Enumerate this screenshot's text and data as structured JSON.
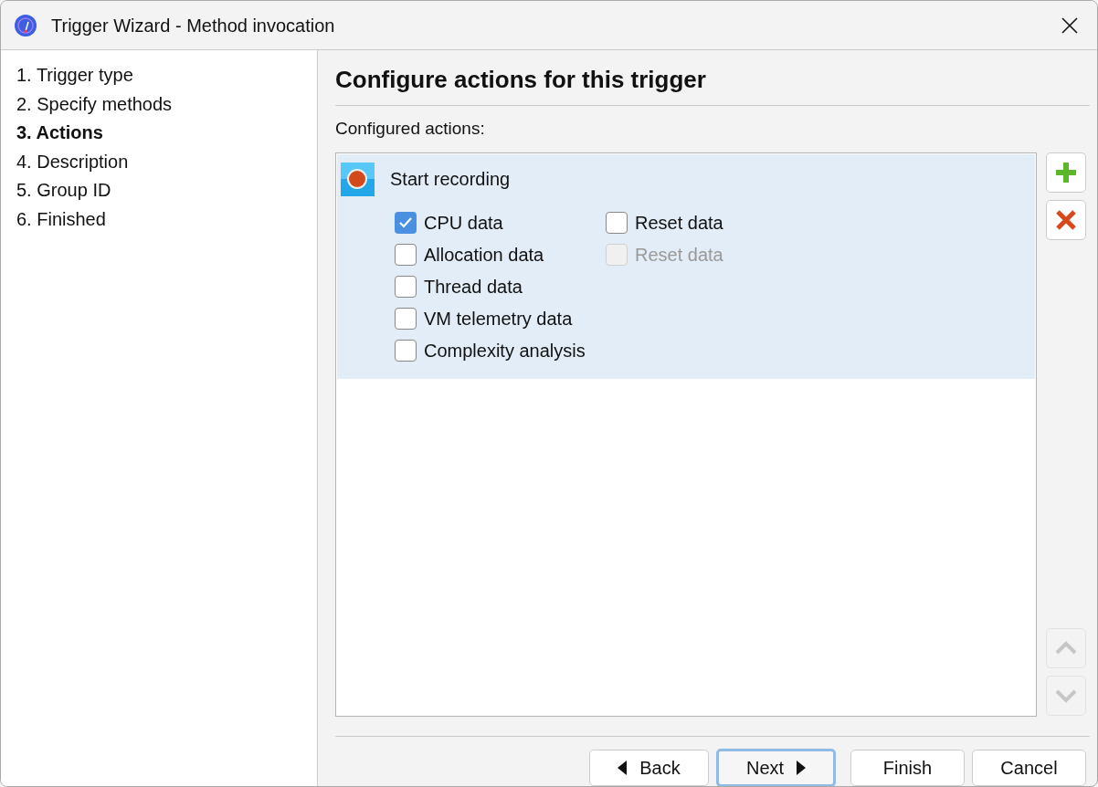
{
  "window": {
    "title": "Trigger Wizard - Method invocation"
  },
  "steps": [
    {
      "label": "1. Trigger type",
      "selected": false
    },
    {
      "label": "2. Specify methods",
      "selected": false
    },
    {
      "label": "3. Actions",
      "selected": true
    },
    {
      "label": "4. Description",
      "selected": false
    },
    {
      "label": "5. Group ID",
      "selected": false
    },
    {
      "label": "6. Finished",
      "selected": false
    }
  ],
  "heading": "Configure actions for this trigger",
  "list_label": "Configured actions:",
  "actions": [
    {
      "label": "Start recording",
      "selected": true,
      "options_left": [
        {
          "label": "CPU data",
          "checked": true,
          "disabled": false
        },
        {
          "label": "Allocation data",
          "checked": false,
          "disabled": false
        },
        {
          "label": "Thread data",
          "checked": false,
          "disabled": false
        },
        {
          "label": "VM telemetry data",
          "checked": false,
          "disabled": false
        },
        {
          "label": "Complexity analysis",
          "checked": false,
          "disabled": false
        }
      ],
      "options_right": [
        {
          "label": "Reset data",
          "checked": false,
          "disabled": false
        },
        {
          "label": "Reset data",
          "checked": false,
          "disabled": true
        }
      ]
    }
  ],
  "side_buttons": [
    {
      "kind": "add",
      "disabled": false
    },
    {
      "kind": "remove",
      "disabled": false
    },
    {
      "kind": "up",
      "disabled": true
    },
    {
      "kind": "down",
      "disabled": true
    }
  ],
  "buttons": [
    {
      "label": "Back",
      "kind": "back",
      "focused": false
    },
    {
      "label": "Next",
      "kind": "next",
      "focused": true
    },
    {
      "label": "Finish",
      "kind": "plain",
      "focused": false
    },
    {
      "label": "Cancel",
      "kind": "plain",
      "focused": false
    }
  ]
}
